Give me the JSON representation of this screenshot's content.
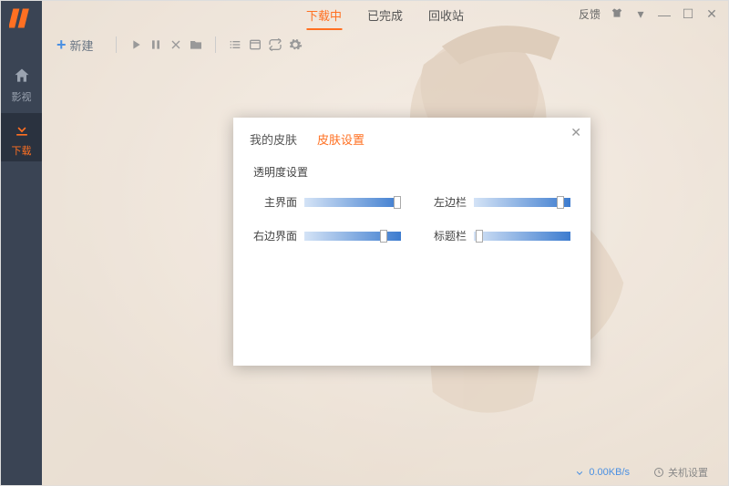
{
  "sidebar": {
    "items": [
      {
        "label": "影视"
      },
      {
        "label": "下载"
      }
    ]
  },
  "header": {
    "tabs": [
      {
        "label": "下载中",
        "active": true
      },
      {
        "label": "已完成"
      },
      {
        "label": "回收站"
      }
    ],
    "feedback": "反馈"
  },
  "toolbar": {
    "new_label": "新建"
  },
  "dialog": {
    "tabs": {
      "my_skin": "我的皮肤",
      "skin_settings": "皮肤设置"
    },
    "section": "透明度设置",
    "sliders": {
      "main": "主界面",
      "left": "左边栏",
      "right": "右边界面",
      "title": "标题栏"
    }
  },
  "footer": {
    "speed": "0.00KB/s",
    "power": "关机设置"
  }
}
